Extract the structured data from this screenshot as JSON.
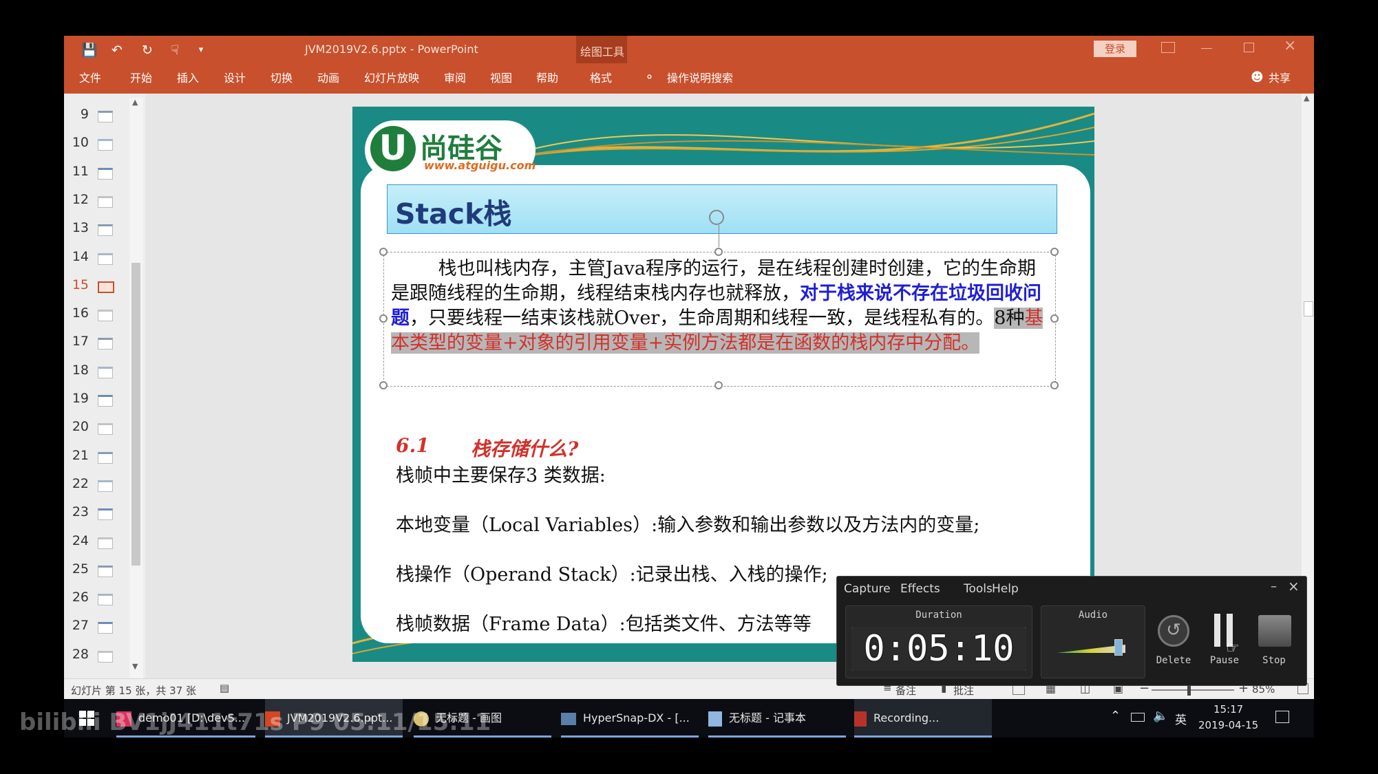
{
  "app": {
    "title": "JVM2019V2.6.pptx  -  PowerPoint",
    "drawing_tools": "绘图工具",
    "login_button": "登录"
  },
  "ribbon_tabs": [
    "文件",
    "开始",
    "插入",
    "设计",
    "切换",
    "动画",
    "幻灯片放映",
    "审阅",
    "视图",
    "帮助",
    "格式"
  ],
  "search_placeholder": "操作说明搜索",
  "share_label": "共享",
  "thumbnails": [
    "9",
    "10",
    "11",
    "12",
    "13",
    "14",
    "15",
    "16",
    "17",
    "18",
    "19",
    "20",
    "21",
    "22",
    "23",
    "24",
    "25",
    "26",
    "27",
    "28"
  ],
  "selected_slide": "15",
  "slide": {
    "logo_cn": "尚硅谷",
    "logo_url": "www.atguigu.com",
    "title": "Stack栈",
    "para_part1": "        栈也叫栈内存，主管Java程序的运行，是在线程创建时创建，它的生命期是跟随线程的生命期，线程结束栈内存也就释放，",
    "para_part2": "对于栈来说不存在垃圾回收问题",
    "para_part3": "，只要线程一结束该栈就Over，生命周期和线程一致，是线程私有的。",
    "para_part4": "8种",
    "para_part5": "基本类型的变量+对象的引用变量+实例方法都是在函数的栈内存中分配。",
    "section_num": "6.1",
    "section_title": "栈存储什么?",
    "line1": "栈帧中主要保存3 类数据:",
    "line2": "本地变量（Local Variables）:输入参数和输出参数以及方法内的变量;",
    "line3": "栈操作（Operand Stack）:记录出栈、入栈的操作;",
    "line4": "栈帧数据（Frame Data）:包括类文件、方法等等"
  },
  "status": {
    "slide_info": "幻灯片 第 15 张，共 37 张",
    "notes": "备注",
    "comments": "批注",
    "zoom": "85%"
  },
  "recorder": {
    "menu": [
      "Capture",
      "Effects",
      "Tools",
      "Help"
    ],
    "duration_label": "Duration",
    "duration": "0:05:10",
    "audio_label": "Audio",
    "delete_label": "Delete",
    "pause_label": "Pause",
    "stop_label": "Stop"
  },
  "taskbar": {
    "items": [
      "demo01 [D:\\devS...",
      "JVM2019V2.6.ppt...",
      "无标题 - 画图",
      "HyperSnap-DX - [...",
      "无标题 - 记事本",
      "Recording..."
    ],
    "ime": "英",
    "time": "15:17",
    "date": "2019-04-15"
  },
  "overlay": {
    "watermark": "BV1jJ411t71s P9 05:11/15:11",
    "brand": "bilibili"
  },
  "colors": {
    "office_accent": "#c8502c",
    "slide_teal": "#1a8a85",
    "highlight_blue": "#1f1fd6",
    "highlight_red": "#d2312b"
  }
}
